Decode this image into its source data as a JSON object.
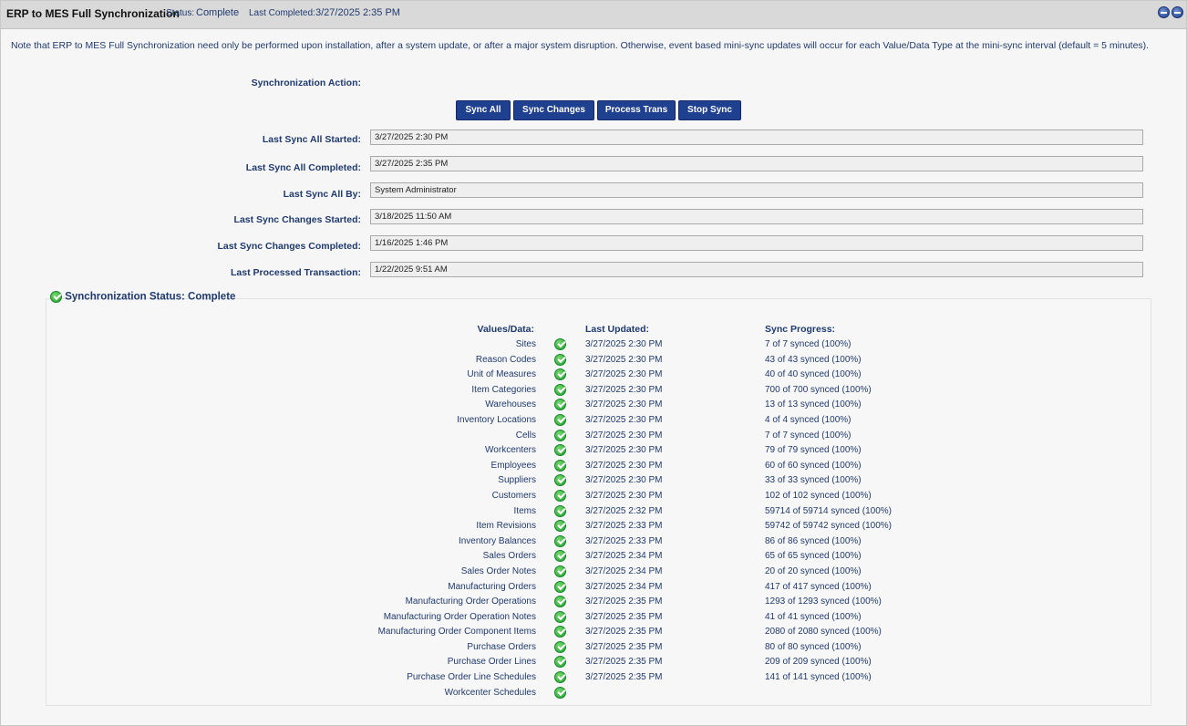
{
  "header": {
    "title": "ERP to MES Full Synchronization",
    "status_label": "Status:",
    "status_value": "Complete",
    "last_completed_label": "Last Completed:",
    "last_completed_value": "3/27/2025 2:35 PM"
  },
  "note": "Note that ERP to MES Full Synchronization need only be performed upon installation, after a system update, or after a major system disruption. Otherwise, event based mini-sync updates will occur for each Value/Data Type at the mini-sync interval (default = 5 minutes).",
  "sync_action_label": "Synchronization Action:",
  "buttons": {
    "sync_all": "Sync All",
    "sync_changes": "Sync Changes",
    "process_trans": "Process Trans",
    "stop_sync": "Stop Sync"
  },
  "fields": [
    {
      "label": "Last Sync All Started:",
      "value": "3/27/2025 2:30 PM"
    },
    {
      "label": "Last Sync All Completed:",
      "value": "3/27/2025 2:35 PM"
    },
    {
      "label": "Last Sync All By:",
      "value": "System Administrator"
    },
    {
      "label": "Last Sync Changes Started:",
      "value": "3/18/2025 11:50 AM"
    },
    {
      "label": "Last Sync Changes Completed:",
      "value": "1/16/2025 1:46 PM"
    },
    {
      "label": "Last Processed Transaction:",
      "value": "1/22/2025 9:51 AM"
    }
  ],
  "sync_status": {
    "title": "Synchronization Status: Complete",
    "col_values": "Values/Data:",
    "col_updated": "Last Updated:",
    "col_progress": "Sync Progress:",
    "rows": [
      {
        "name": "Sites",
        "updated": "3/27/2025 2:30 PM",
        "progress": "7 of 7 synced (100%)"
      },
      {
        "name": "Reason Codes",
        "updated": "3/27/2025 2:30 PM",
        "progress": "43 of 43 synced (100%)"
      },
      {
        "name": "Unit of Measures",
        "updated": "3/27/2025 2:30 PM",
        "progress": "40 of 40 synced (100%)"
      },
      {
        "name": "Item Categories",
        "updated": "3/27/2025 2:30 PM",
        "progress": "700 of 700 synced (100%)"
      },
      {
        "name": "Warehouses",
        "updated": "3/27/2025 2:30 PM",
        "progress": "13 of 13 synced (100%)"
      },
      {
        "name": "Inventory Locations",
        "updated": "3/27/2025 2:30 PM",
        "progress": "4 of 4 synced (100%)"
      },
      {
        "name": "Cells",
        "updated": "3/27/2025 2:30 PM",
        "progress": "7 of 7 synced (100%)"
      },
      {
        "name": "Workcenters",
        "updated": "3/27/2025 2:30 PM",
        "progress": "79 of 79 synced (100%)"
      },
      {
        "name": "Employees",
        "updated": "3/27/2025 2:30 PM",
        "progress": "60 of 60 synced (100%)"
      },
      {
        "name": "Suppliers",
        "updated": "3/27/2025 2:30 PM",
        "progress": "33 of 33 synced (100%)"
      },
      {
        "name": "Customers",
        "updated": "3/27/2025 2:30 PM",
        "progress": "102 of 102 synced (100%)"
      },
      {
        "name": "Items",
        "updated": "3/27/2025 2:32 PM",
        "progress": "59714 of 59714 synced (100%)"
      },
      {
        "name": "Item Revisions",
        "updated": "3/27/2025 2:33 PM",
        "progress": "59742 of 59742 synced (100%)"
      },
      {
        "name": "Inventory Balances",
        "updated": "3/27/2025 2:33 PM",
        "progress": "86 of 86 synced (100%)"
      },
      {
        "name": "Sales Orders",
        "updated": "3/27/2025 2:34 PM",
        "progress": "65 of 65 synced (100%)"
      },
      {
        "name": "Sales Order Notes",
        "updated": "3/27/2025 2:34 PM",
        "progress": "20 of 20 synced (100%)"
      },
      {
        "name": "Manufacturing Orders",
        "updated": "3/27/2025 2:34 PM",
        "progress": "417 of 417 synced (100%)"
      },
      {
        "name": "Manufacturing Order Operations",
        "updated": "3/27/2025 2:35 PM",
        "progress": "1293 of 1293 synced (100%)"
      },
      {
        "name": "Manufacturing Order Operation Notes",
        "updated": "3/27/2025 2:35 PM",
        "progress": "41 of 41 synced (100%)"
      },
      {
        "name": "Manufacturing Order Component Items",
        "updated": "3/27/2025 2:35 PM",
        "progress": "2080 of 2080 synced (100%)"
      },
      {
        "name": "Purchase Orders",
        "updated": "3/27/2025 2:35 PM",
        "progress": "80 of 80 synced (100%)"
      },
      {
        "name": "Purchase Order Lines",
        "updated": "3/27/2025 2:35 PM",
        "progress": "209 of 209 synced (100%)"
      },
      {
        "name": "Purchase Order Line Schedules",
        "updated": "3/27/2025 2:35 PM",
        "progress": "141 of 141 synced (100%)"
      },
      {
        "name": "Workcenter Schedules",
        "updated": "",
        "progress": ""
      }
    ]
  }
}
